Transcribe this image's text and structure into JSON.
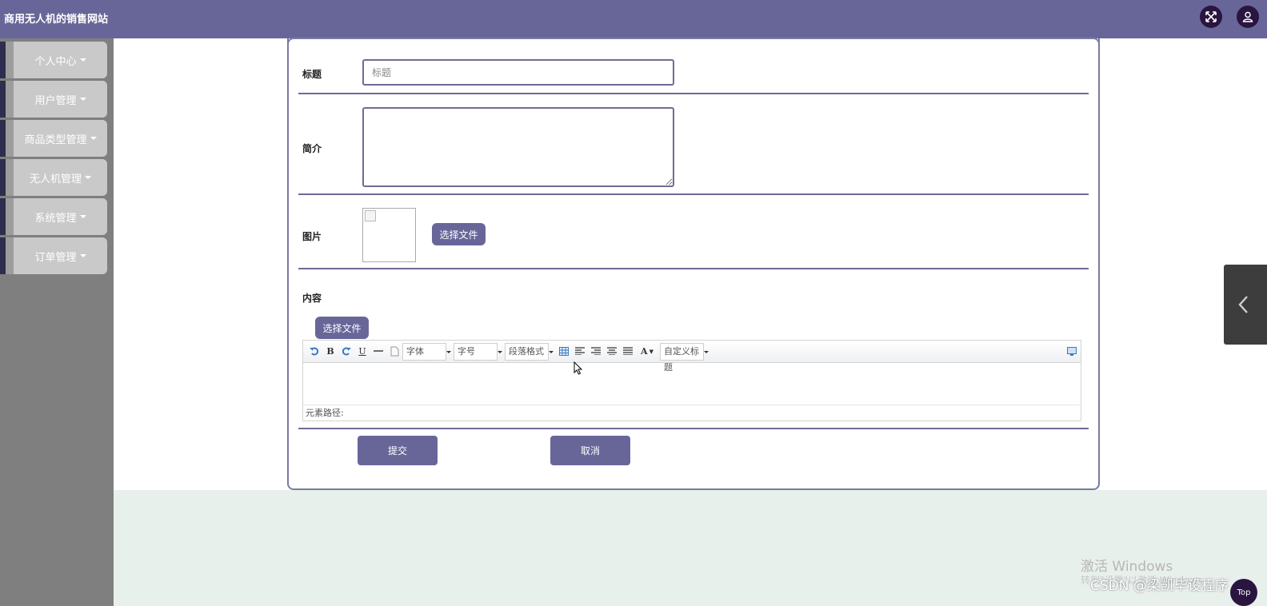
{
  "header": {
    "title": "商用无人机的销售网站",
    "expand_icon": "expand-icon",
    "user_icon": "user-icon"
  },
  "sidebar": {
    "items": [
      {
        "label": "个人中心"
      },
      {
        "label": "用户管理"
      },
      {
        "label": "商品类型管理"
      },
      {
        "label": "无人机管理"
      },
      {
        "label": "系统管理"
      },
      {
        "label": "订单管理"
      }
    ]
  },
  "form": {
    "title_label": "标题",
    "title_placeholder": "标题",
    "title_value": "",
    "intro_label": "简介",
    "intro_value": "",
    "image_label": "图片",
    "image_choose_button": "选择文件",
    "content_label": "内容",
    "content_choose_button": "选择文件",
    "submit_button": "提交",
    "cancel_button": "取消"
  },
  "editor": {
    "font_combo": "字体",
    "size_combo": "字号",
    "paragraph_combo": "段落格式",
    "custom_title_combo": "自定义标题",
    "path_label": "元素路径:",
    "tool_icons": [
      "undo-icon",
      "bold-icon",
      "redo-icon",
      "underline-icon",
      "horizontal-rule-icon",
      "paste-text-icon",
      "table-icon",
      "align-left-icon",
      "align-right-icon",
      "align-center-icon",
      "justify-icon",
      "font-color-icon",
      "fullscreen-icon"
    ]
  },
  "overlay": {
    "activate_windows": "激活 Windows",
    "activate_hint": "转到\"设置\"以激活 Windows。",
    "csdn_watermark": "CSDN @梁凯毕设程序",
    "top_button": "Top"
  },
  "colors": {
    "header_bg": "#686699",
    "accent_button": "#686699",
    "sidebar_bg": "#7f7f7f",
    "nav_button": "#c9c9c9",
    "dark_badge": "#2a1540"
  }
}
